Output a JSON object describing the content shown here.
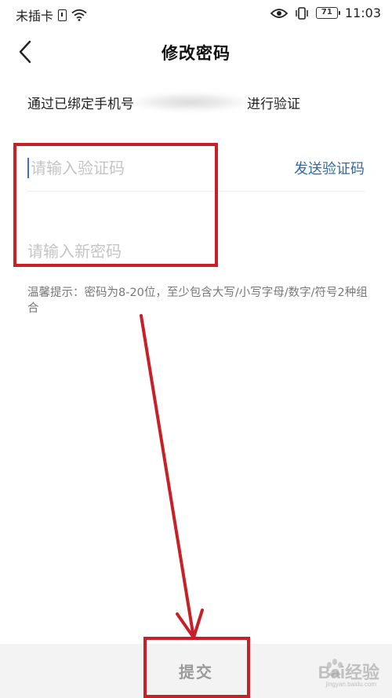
{
  "status_bar": {
    "carrier": "未插卡",
    "battery": "71",
    "time": "11:03"
  },
  "header": {
    "title": "修改密码"
  },
  "verify": {
    "prefix": "通过已绑定手机号",
    "suffix": "进行验证"
  },
  "form": {
    "code_placeholder": "请输入验证码",
    "send_code_label": "发送验证码",
    "password_placeholder": "请输入新密码"
  },
  "hint": "温馨提示：密码为8-20位，至少包含大写/小写字母/数字/符号2种组合",
  "submit_label": "提交",
  "watermark": {
    "text": "Bai经验",
    "url": "jingyan.baidu.com"
  },
  "colors": {
    "annotation": "#c91f26",
    "link": "#2f6aa9",
    "caret": "#3b6fd6"
  }
}
